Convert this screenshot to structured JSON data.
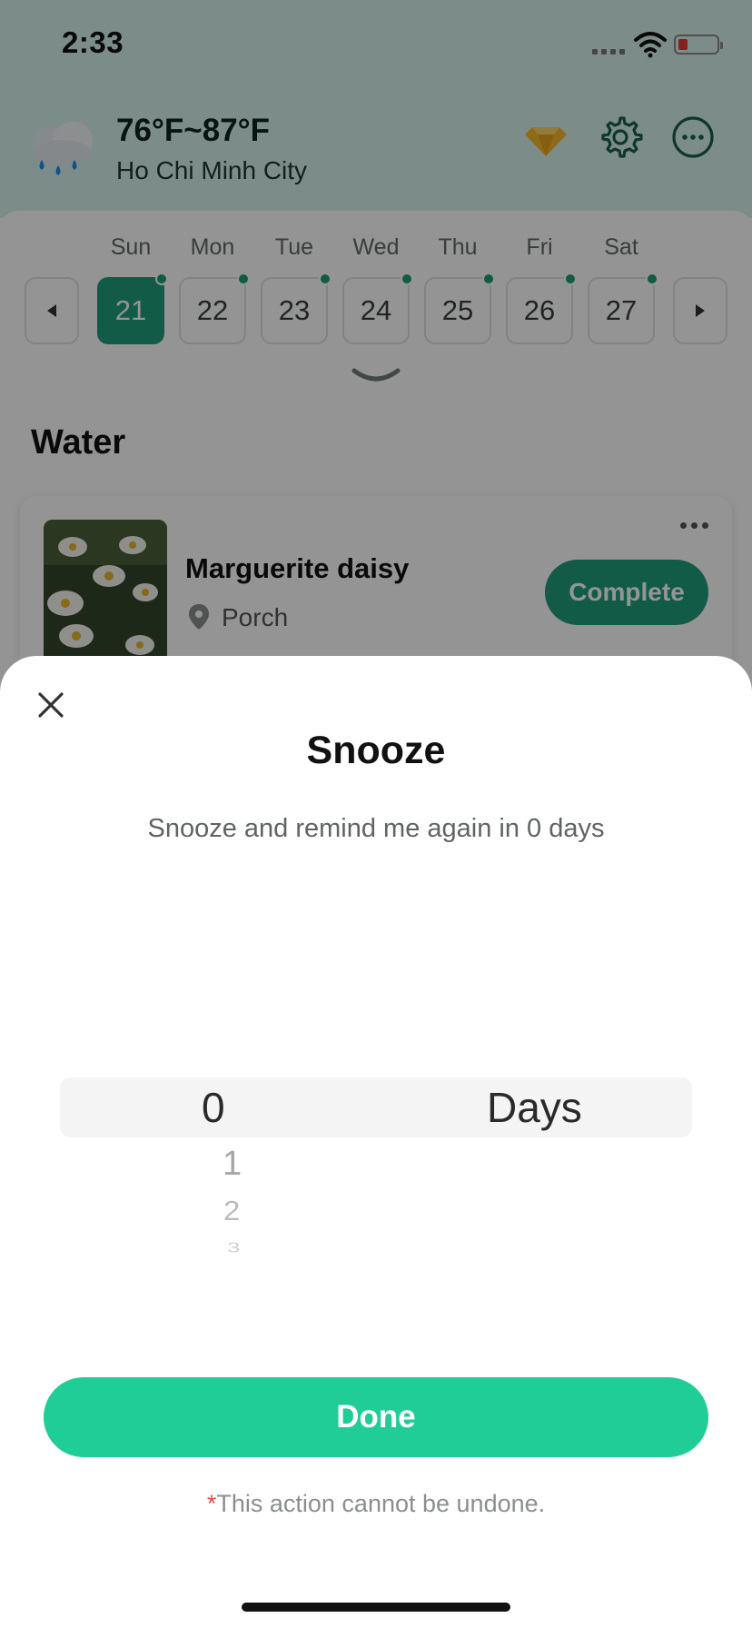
{
  "status_bar": {
    "time": "2:33"
  },
  "header": {
    "temperature": "76°F~87°F",
    "city": "Ho Chi Minh City"
  },
  "calendar": {
    "weekdays": [
      "Sun",
      "Mon",
      "Tue",
      "Wed",
      "Thu",
      "Fri",
      "Sat"
    ],
    "dates": [
      "21",
      "22",
      "23",
      "24",
      "25",
      "26",
      "27"
    ],
    "selected_index": 0
  },
  "section": {
    "title": "Water"
  },
  "task_card": {
    "plant_name": "Marguerite daisy",
    "location": "Porch",
    "complete_label": "Complete"
  },
  "sheet": {
    "title": "Snooze",
    "subtitle": "Snooze and remind me again in 0 days",
    "picker": {
      "selected_value": "0",
      "unit": "Days",
      "options": [
        "1",
        "2",
        "3"
      ]
    },
    "done_label": "Done",
    "note_star": "*",
    "note": "This action cannot be undone."
  },
  "colors": {
    "accent": "#1f9e7a",
    "done_button": "#21cd97",
    "warning_star": "#e64b4b"
  }
}
